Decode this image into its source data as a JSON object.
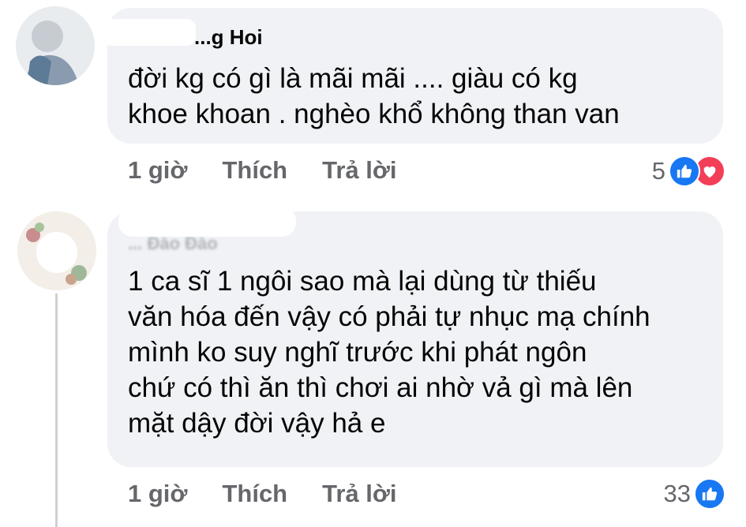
{
  "comments": [
    {
      "author": "...g Hoi",
      "text": "đời kg có gì là mãi mãi .... giàu có kg\nkhoe khoan . nghèo khổ không than van",
      "time": "1 giờ",
      "like_label": "Thích",
      "reply_label": "Trả lời",
      "reaction_count": "5",
      "reactions": [
        "like-icon",
        "love-icon"
      ]
    },
    {
      "author": "... Đào Đào",
      "text": "1 ca sĩ 1 ngôi sao mà lại dùng từ thiếu\nvăn hóa đến vậy có phải tự nhục mạ chính\nmình ko suy nghĩ trước khi phát ngôn\nchứ có thì ăn thì chơi ai nhờ vả gì mà lên\nmặt dậy đời vậy hả e",
      "time": "1 giờ",
      "like_label": "Thích",
      "reply_label": "Trả lời",
      "reaction_count": "33",
      "reactions": [
        "like-icon"
      ]
    }
  ],
  "colors": {
    "bubble": "#f0f2f5",
    "meta_text": "#65676b",
    "like": "#1877f2",
    "love": "#f33e58",
    "thread_line": "#ced0d4"
  }
}
